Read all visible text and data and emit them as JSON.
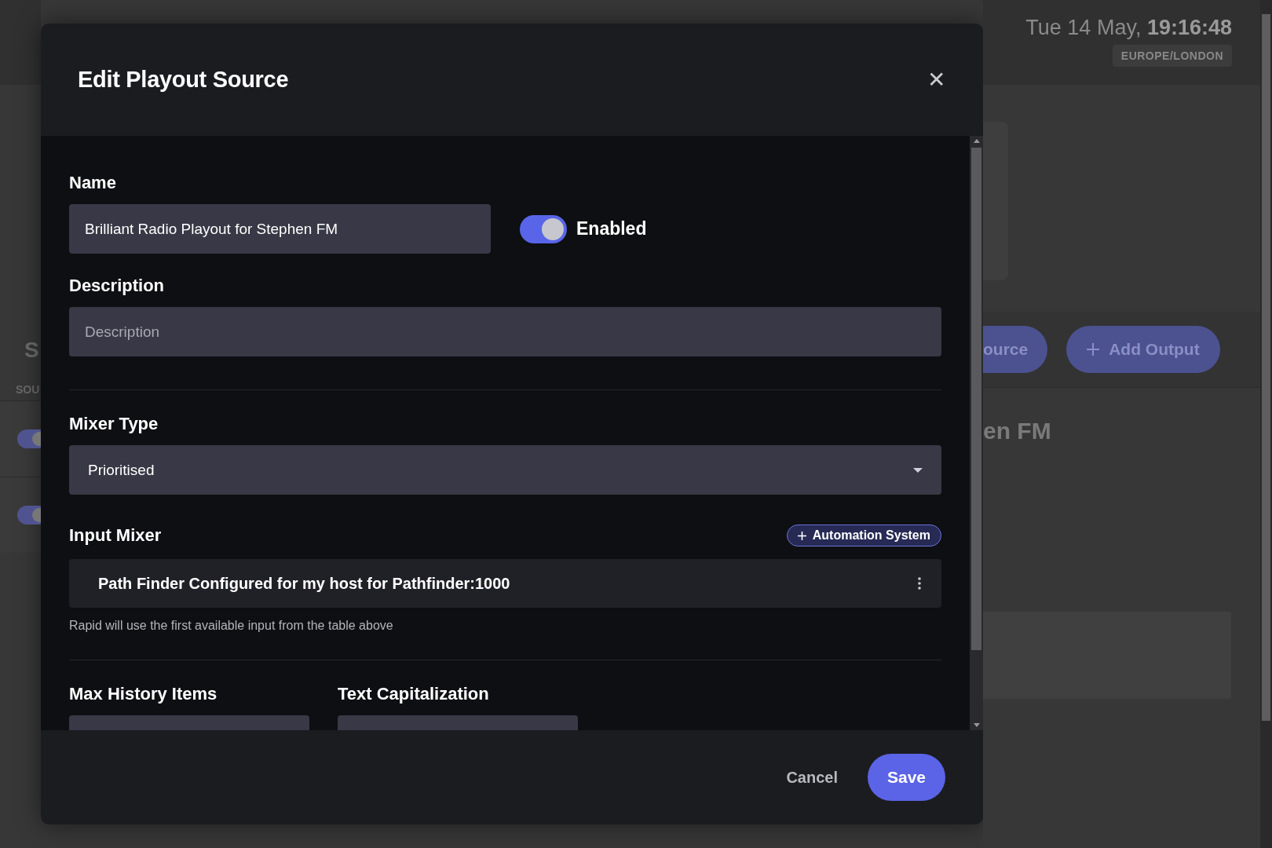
{
  "background": {
    "date": "Tue 14 May,",
    "time": "19:16:48",
    "timezone": "EUROPE/LONDON",
    "section_letter": "S",
    "column_label": "SOU",
    "source_rows": [
      {
        "on": true
      },
      {
        "on": true
      }
    ],
    "buttons": [
      "ource",
      "Add Output"
    ],
    "heading": "en FM"
  },
  "dialog": {
    "title": "Edit Playout Source",
    "close": "✕",
    "name": {
      "label": "Name",
      "value": "Brilliant Radio Playout for Stephen FM"
    },
    "enabled": {
      "label": "Enabled",
      "on": true
    },
    "description": {
      "label": "Description",
      "placeholder": "Description"
    },
    "mixer_type": {
      "label": "Mixer Type",
      "value": "Prioritised"
    },
    "input_mixer": {
      "label": "Input Mixer",
      "add_button": "Automation System",
      "rows": [
        "Path Finder Configured for my host for Pathfinder:1000"
      ],
      "hint": "Rapid will use the first available input from the table above"
    },
    "bottom_fields": [
      "Max History Items",
      "Text Capitalization"
    ],
    "buttons": {
      "cancel": "Cancel",
      "save": "Save"
    }
  }
}
